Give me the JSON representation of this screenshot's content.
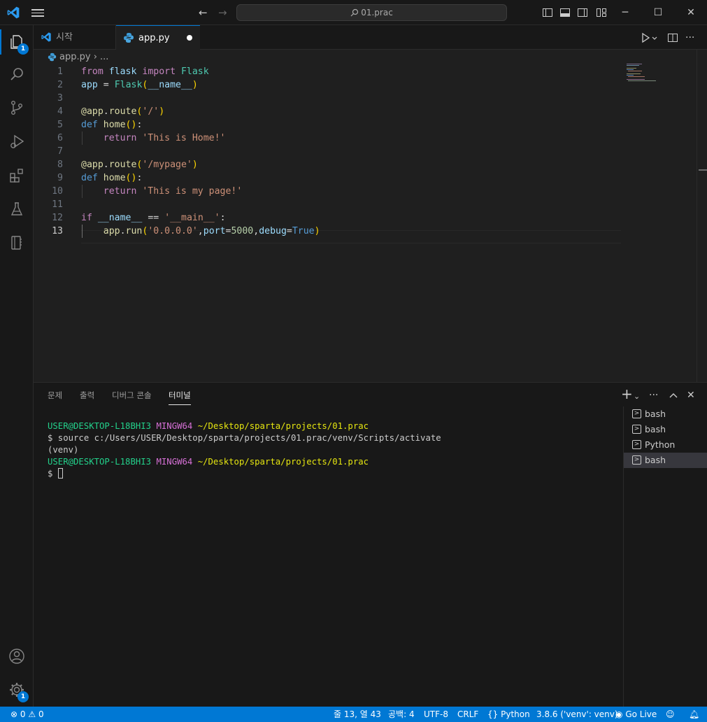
{
  "window": {
    "title": "01.prac"
  },
  "activity": {
    "explorer_badge": "1",
    "settings_badge": "1"
  },
  "tabs": [
    {
      "label": "시작"
    },
    {
      "label": "app.py"
    }
  ],
  "breadcrumb": {
    "file": "app.py",
    "more": "..."
  },
  "editor": {
    "language": "python",
    "current_line": 13,
    "lines": [
      "from flask import Flask",
      "app = Flask(__name__)",
      "",
      "@app.route('/')",
      "def home():",
      "    return 'This is Home!'",
      "",
      "@app.route('/mypage')",
      "def home():",
      "    return 'This is my page!'",
      "",
      "if __name__ == '__main__':",
      "    app.run('0.0.0.0',port=5000,debug=True)"
    ]
  },
  "panel": {
    "tabs": [
      "문제",
      "출력",
      "디버그 콘솔",
      "터미널"
    ],
    "active_tab": "터미널",
    "terminal": {
      "prompt_user": "USER@DESKTOP-L18BHI3",
      "prompt_env": "MINGW64",
      "prompt_path": "~/Desktop/sparta/projects/01.prac",
      "command": "$ source c:/Users/USER/Desktop/sparta/projects/01.prac/venv/Scripts/activate",
      "venv": "(venv)",
      "prompt_symbol": "$"
    },
    "terminal_list": [
      "bash",
      "bash",
      "Python",
      "bash"
    ],
    "selected_terminal": 3
  },
  "statusbar": {
    "errors": "0",
    "warnings": "0",
    "position": "줄 13, 열 43",
    "spaces": "공백: 4",
    "encoding": "UTF-8",
    "eol": "CRLF",
    "language": "Python",
    "interpreter": "3.8.6 ('venv': venv)",
    "golive": "Go Live"
  },
  "colors": {
    "accent": "#0078d4",
    "background": "#1f1f1f",
    "sidebar": "#181818"
  }
}
